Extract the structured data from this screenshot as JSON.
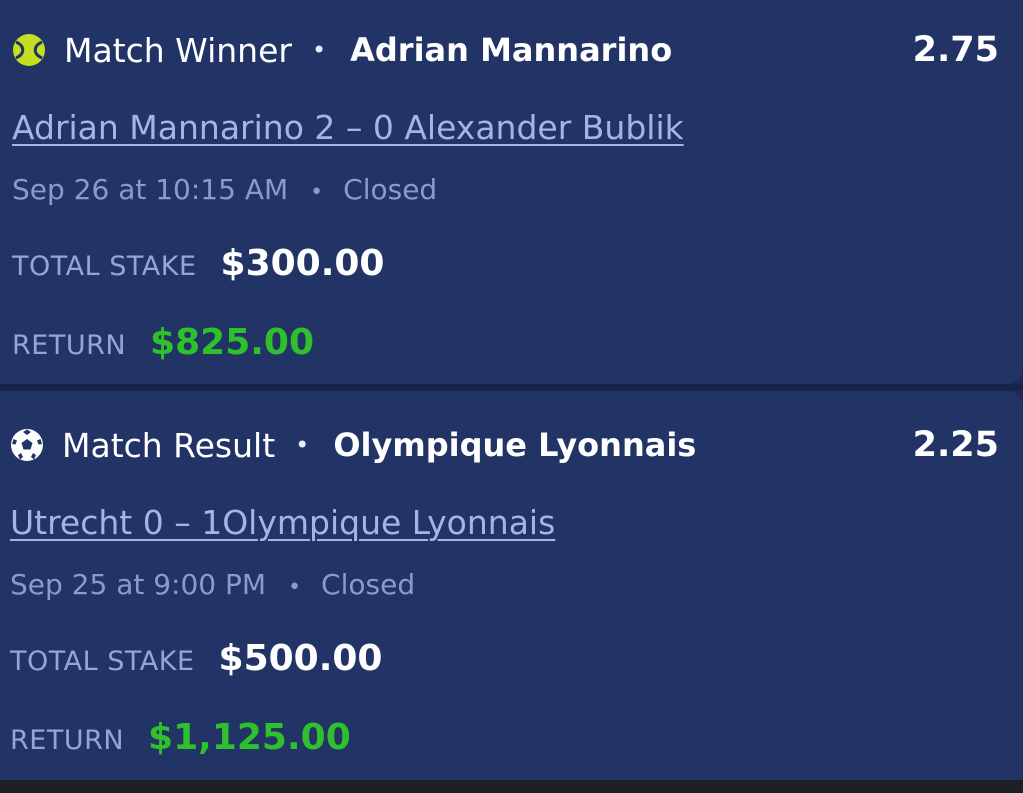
{
  "bets": [
    {
      "sport_icon": "tennis-ball-icon",
      "market": "Match Winner",
      "separator": "•",
      "selection": "Adrian Mannarino",
      "odds": "2.75",
      "event": "Adrian Mannarino 2 – 0 Alexander Bublik",
      "datetime": "Sep 26 at 10:15 AM",
      "status": "Closed",
      "stake_label": "TOTAL STAKE",
      "stake": "$300.00",
      "return_label": "RETURN",
      "return_amount": "$825.00"
    },
    {
      "sport_icon": "soccer-ball-icon",
      "market": "Match Result",
      "separator": "•",
      "selection": "Olympique Lyonnais",
      "odds": "2.25",
      "event": "Utrecht 0 – 1Olympique Lyonnais",
      "datetime": "Sep 25 at 9:00 PM",
      "status": "Closed",
      "stake_label": "TOTAL STAKE",
      "stake": "$500.00",
      "return_label": "RETURN",
      "return_amount": "$1,125.00"
    }
  ],
  "colors": {
    "card_background": "#223366",
    "page_background": "#1b2a56",
    "event_link": "#a7b4e2",
    "muted_text": "#8d9ac6",
    "return_green": "#2fc12b",
    "tennis_ball": "#c5df20"
  }
}
